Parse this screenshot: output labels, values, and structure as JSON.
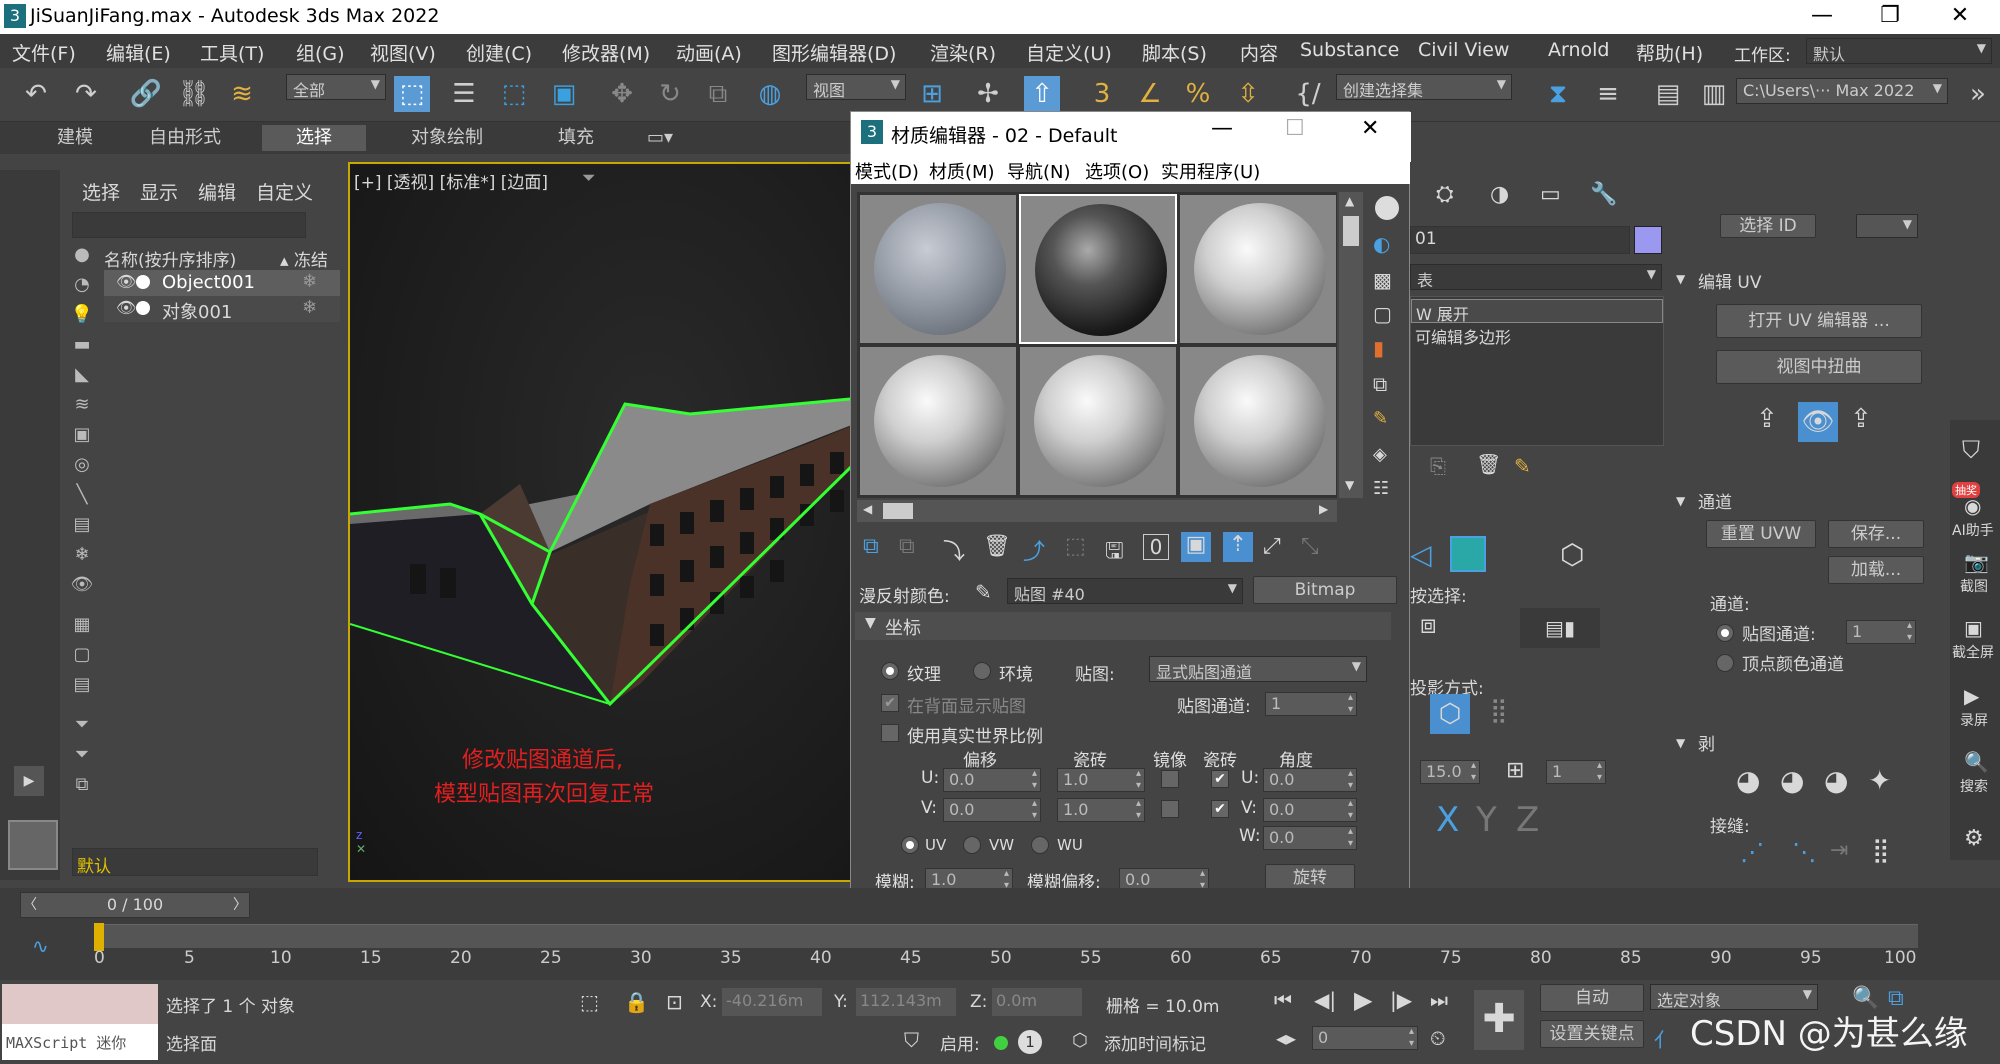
{
  "window": {
    "title": "JiSuanJiFang.max - Autodesk 3ds Max 2022"
  },
  "menu": [
    "文件(F)",
    "编辑(E)",
    "工具(T)",
    "组(G)",
    "视图(V)",
    "创建(C)",
    "修改器(M)",
    "动画(A)",
    "图形编辑器(D)",
    "渲染(R)",
    "自定义(U)",
    "脚本(S)",
    "内容",
    "Substance",
    "Civil View",
    "Arnold",
    "帮助(H)"
  ],
  "workspace": {
    "label": "工作区:",
    "value": "默认"
  },
  "toolbar": {
    "filter": "全部",
    "view": "视图",
    "selset": "创建选择集",
    "path": "C:\\Users\\··· Max 2022"
  },
  "ribbon": [
    "建模",
    "自由形式",
    "选择",
    "对象绘制",
    "填充"
  ],
  "scene": {
    "tabs": [
      "选择",
      "显示",
      "编辑",
      "自定义"
    ],
    "header_name": "名称(按升序排序)",
    "header_freeze": "▴ 冻结",
    "rows": [
      "Object001",
      "对象001"
    ],
    "layer": "默认"
  },
  "viewport": {
    "label": "[+] [透视] [标准*] [边面]",
    "annotation1": "修改贴图通道后,",
    "annotation2": "模型贴图再次回复正常"
  },
  "mat": {
    "title": "材质编辑器 - 02 - Default",
    "menu": [
      "模式(D)",
      "材质(M)",
      "导航(N)",
      "选项(O)",
      "实用程序(U)"
    ],
    "diffuse_label": "漫反射颜色:",
    "map_name": "贴图 #40",
    "map_type": "Bitmap",
    "rollout": "坐标",
    "tex": "纹理",
    "env": "环境",
    "map_label": "贴图:",
    "map_value": "显式贴图通道",
    "backface": "在背面显示贴图",
    "channel_label": "贴图通道:",
    "channel_value": "1",
    "realworld": "使用真实世界比例",
    "col_offset": "偏移",
    "col_tiling": "瓷砖",
    "col_mirror": "镜像",
    "col_tile": "瓷砖",
    "col_angle": "角度",
    "u": "U:",
    "v": "V:",
    "w": "W:",
    "u_off": "0.0",
    "v_off": "0.0",
    "u_tile": "1.0",
    "v_tile": "1.0",
    "u_ang": "0.0",
    "v_ang": "0.0",
    "w_ang": "0.0",
    "uv": "UV",
    "vw": "VW",
    "wu": "WU",
    "blur_label": "模糊:",
    "blur": "1.0",
    "bluroff_label": "模糊偏移:",
    "bluroff": "0.0",
    "rotate": "旋转"
  },
  "right": {
    "obj_name": "01",
    "modlist": "表",
    "stack": [
      "W 展开",
      "可编辑多边形"
    ],
    "select_id": "选择 ID",
    "edit_uv": "编辑 UV",
    "open_uv": "打开 UV 编辑器 ...",
    "view_distort": "视图中扭曲",
    "channel_sec": "通道",
    "reset_uvw": "重置 UVW",
    "save": "保存...",
    "load": "加载...",
    "channel_label": "通道:",
    "map_channel": "贴图通道:",
    "map_channel_val": "1",
    "vertex_color": "顶点颜色通道",
    "peel": "剥",
    "stitch": "接缝:",
    "by_select": "按选择:",
    "method": "投影方式:",
    "val15": "15.0",
    "val1": "1",
    "xyz": [
      "X",
      "Y",
      "Z"
    ]
  },
  "side": [
    "AI助手",
    "截图",
    "截全屏",
    "录屏",
    "搜索"
  ],
  "side_badge": "抽奖",
  "timeline": {
    "frame": "0 / 100",
    "ticks": [
      "0",
      "5",
      "10",
      "15",
      "20",
      "25",
      "30",
      "35",
      "40",
      "45",
      "50",
      "55",
      "60",
      "65",
      "70",
      "75",
      "80",
      "85",
      "90",
      "95",
      "100"
    ]
  },
  "status": {
    "maxscript": "MAXScript 迷你",
    "selected": "选择了 1 个 对象",
    "select_face": "选择面",
    "x_label": "X:",
    "x": "-40.216m",
    "y_label": "Y:",
    "y": "112.143m",
    "z_label": "Z:",
    "z": "0.0m",
    "grid": "栅格 = 10.0m",
    "enable": "启用:",
    "addtime": "添加时间标记",
    "auto": "自动",
    "setkey": "设置关键点",
    "selobj": "选定对象",
    "frame_val": "0",
    "watermark": "CSDN @为甚么缘"
  }
}
